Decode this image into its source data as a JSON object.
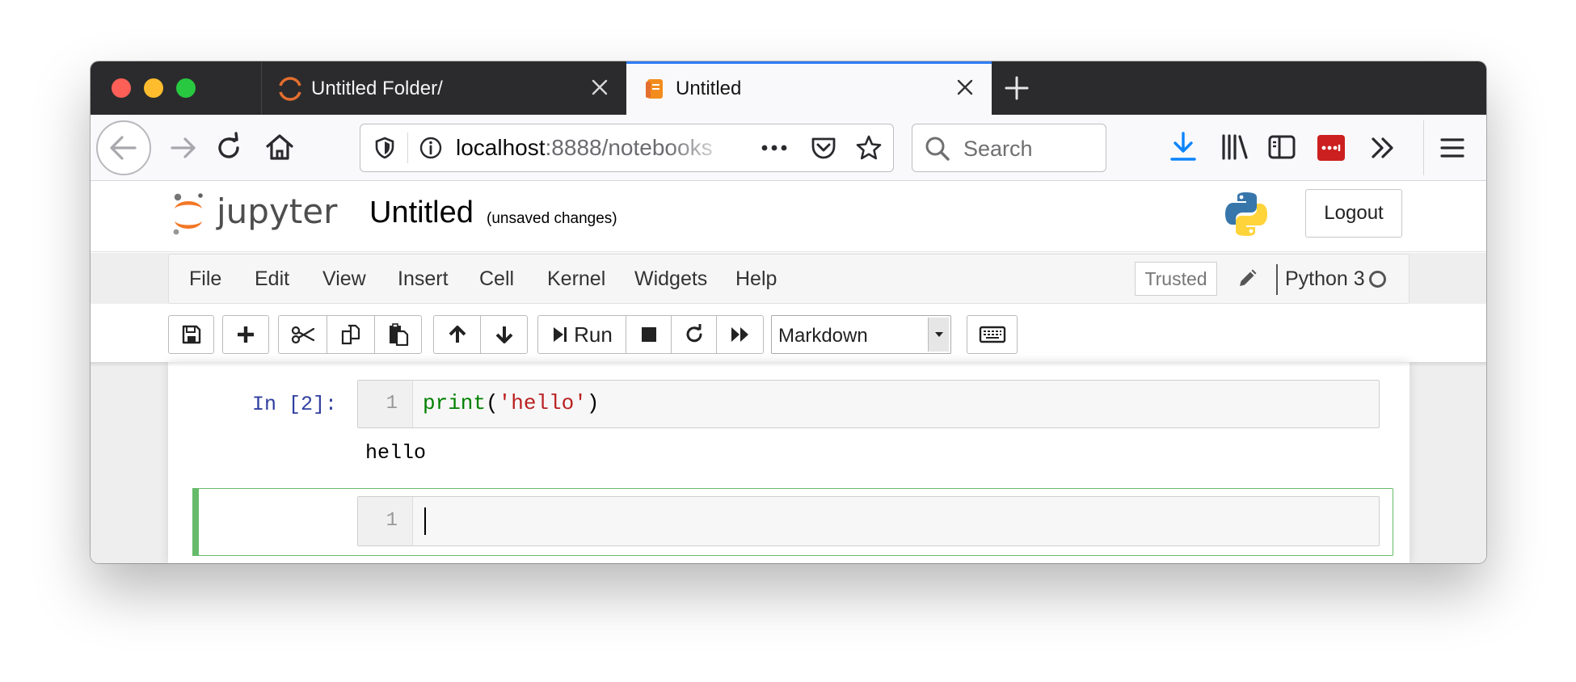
{
  "browser": {
    "tabs": [
      {
        "title": "Untitled Folder/",
        "active": false
      },
      {
        "title": "Untitled",
        "active": true
      }
    ],
    "url_host": "localhost",
    "url_rest": ":8888/notebooks",
    "search_placeholder": "Search",
    "accent_color": "#2f7cf6"
  },
  "jupyter": {
    "logo_text": "jupyter",
    "notebook_title": "Untitled",
    "save_status": "(unsaved changes)",
    "logout_label": "Logout",
    "menu": [
      "File",
      "Edit",
      "View",
      "Insert",
      "Cell",
      "Kernel",
      "Widgets",
      "Help"
    ],
    "trusted_label": "Trusted",
    "kernel_name": "Python 3",
    "toolbar": {
      "run_label": "Run",
      "cell_type": "Markdown"
    },
    "cells": [
      {
        "prompt": "In [2]:",
        "line_number": "1",
        "code_fn": "print",
        "code_open": "(",
        "code_str": "'hello'",
        "code_close": ")",
        "output": "hello"
      },
      {
        "prompt": "",
        "line_number": "1",
        "selected": true
      }
    ]
  }
}
